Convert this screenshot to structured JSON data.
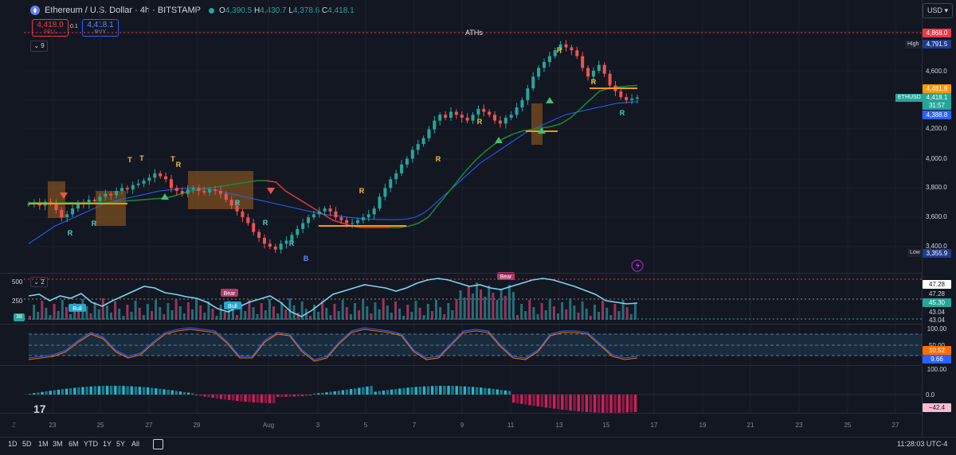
{
  "header": {
    "title": "Ethereum / U.S. Dollar · 4h · BITSTAMP",
    "ohlc": {
      "o": "4,390.5",
      "h": "4,430.7",
      "l": "4,378.6",
      "c": "4,418.1"
    },
    "sell_price": "4,418.0",
    "sell_label": "SELL",
    "buy_price": "4,418.1",
    "buy_label": "BUY",
    "spread": "0.1",
    "indicator_count": "9",
    "currency": "USD"
  },
  "annotations": {
    "ath_label": "ATHs",
    "high_label": "High",
    "low_label": "Low"
  },
  "right_tags": {
    "ath": "4,868.0",
    "high": "4,791.5",
    "orange": "4,481.8",
    "last": "4,418.1",
    "countdown": "31:57",
    "blue": "4,388.8",
    "low": "3,355.9",
    "symbol": "ETHUSD"
  },
  "panes": {
    "volume": {
      "collapse": "2",
      "left_top": "500",
      "left_mid": "250",
      "left_badge": "38",
      "tags": [
        "47.28",
        "47.28",
        "45.30",
        "43.04",
        "43.04"
      ]
    },
    "stoch": {
      "tags": [
        "100.00",
        "50.00",
        "10.52",
        "9.66",
        "100.00"
      ]
    },
    "macd": {
      "zero": "0.0",
      "value": "−42.4"
    }
  },
  "marker_labels": {
    "bull": "Bull",
    "bear": "Bear",
    "r": "R",
    "t": "T",
    "b": "B"
  },
  "range_buttons": [
    "1D",
    "5D",
    "1M",
    "3M",
    "6M",
    "YTD",
    "1Y",
    "5Y",
    "All"
  ],
  "clock": "11:28:03 UTC-4",
  "zoom_label": "Z",
  "colors": {
    "up": "#26a69a",
    "down": "#ef5350",
    "ema_blue": "#2962ff",
    "band_green": "#1b8a3a",
    "band_red": "#e03a3a",
    "orange": "#ff9800",
    "bg": "#131722"
  },
  "chart_data": {
    "type": "candlestick",
    "interval": "4h",
    "x_ticks": [
      "23",
      "25",
      "27",
      "29",
      "Aug",
      "3",
      "5",
      "7",
      "9",
      "11",
      "13",
      "15",
      "17",
      "19",
      "21",
      "23",
      "25",
      "27"
    ],
    "y_ticks": [
      3400,
      3600,
      3800,
      4000,
      4200,
      4400,
      4600
    ],
    "ylim": [
      3300,
      4900
    ],
    "closes": [
      3690,
      3700,
      3680,
      3705,
      3695,
      3650,
      3600,
      3620,
      3660,
      3700,
      3690,
      3720,
      3710,
      3740,
      3760,
      3750,
      3780,
      3800,
      3790,
      3820,
      3830,
      3850,
      3870,
      3900,
      3880,
      3860,
      3800,
      3780,
      3760,
      3790,
      3800,
      3780,
      3770,
      3790,
      3780,
      3760,
      3720,
      3680,
      3640,
      3600,
      3560,
      3500,
      3460,
      3420,
      3400,
      3380,
      3420,
      3440,
      3480,
      3520,
      3560,
      3600,
      3620,
      3640,
      3660,
      3640,
      3600,
      3580,
      3560,
      3560,
      3580,
      3600,
      3620,
      3660,
      3740,
      3800,
      3860,
      3900,
      3960,
      4000,
      4060,
      4100,
      4140,
      4200,
      4260,
      4300,
      4280,
      4320,
      4300,
      4280,
      4260,
      4300,
      4340,
      4320,
      4300,
      4260,
      4240,
      4280,
      4300,
      4350,
      4400,
      4480,
      4560,
      4620,
      4660,
      4700,
      4740,
      4780,
      4760,
      4740,
      4700,
      4620,
      4560,
      4600,
      4640,
      4580,
      4500,
      4460,
      4420,
      4400,
      4410,
      4418
    ],
    "series": [
      {
        "name": "EMA",
        "values": [
          3420,
          3450,
          3480,
          3510,
          3540,
          3560,
          3580,
          3600,
          3620,
          3640,
          3660,
          3680,
          3700,
          3710,
          3720,
          3730,
          3740,
          3750,
          3760,
          3770,
          3780,
          3785,
          3790,
          3795,
          3798,
          3800,
          3800,
          3795,
          3790,
          3780,
          3770,
          3760,
          3750,
          3740,
          3730,
          3720,
          3710,
          3700,
          3690,
          3680,
          3670,
          3660,
          3650,
          3640,
          3630,
          3620,
          3615,
          3610,
          3605,
          3600,
          3595,
          3590,
          3588,
          3586,
          3585,
          3584,
          3584,
          3585,
          3590,
          3600,
          3620,
          3650,
          3690,
          3730,
          3770,
          3810,
          3850,
          3890,
          3930,
          3970,
          4000,
          4030,
          4060,
          4090,
          4120,
          4150,
          4180,
          4200,
          4220,
          4240,
          4260,
          4280,
          4300,
          4310,
          4320,
          4330,
          4340,
          4350,
          4360,
          4370,
          4378,
          4382,
          4386,
          4388
        ]
      },
      {
        "name": "Trail",
        "values": [
          3700,
          3700,
          3700,
          3700,
          3700,
          3700,
          3700,
          3700,
          3700,
          3705,
          3710,
          3715,
          3720,
          3725,
          3730,
          3740,
          3760,
          3780,
          3790,
          3800,
          3810,
          3820,
          3830,
          3840,
          3850,
          3850,
          3840,
          3780,
          3740,
          3700,
          3660,
          3620,
          3580,
          3560,
          3540,
          3530,
          3530,
          3530,
          3530,
          3530,
          3540,
          3560,
          3600,
          3680,
          3760,
          3840,
          3920,
          3990,
          4050,
          4100,
          4140,
          4170,
          4190,
          4200,
          4210,
          4220,
          4240,
          4280,
          4340,
          4400,
          4460,
          4480,
          4490,
          4495,
          4500
        ]
      }
    ]
  }
}
